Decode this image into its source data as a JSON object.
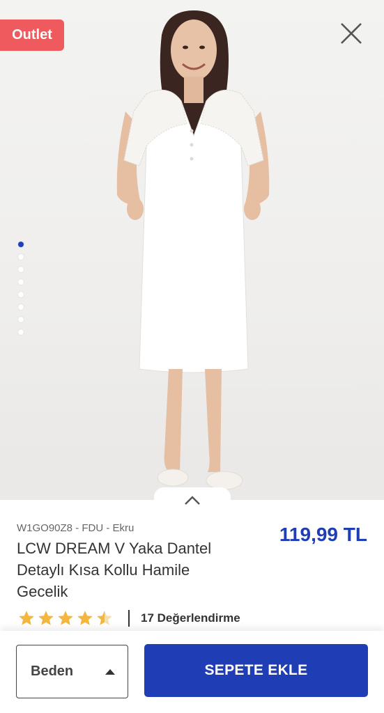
{
  "badge": {
    "label": "Outlet"
  },
  "gallery": {
    "image_count": 8,
    "active_index": 0
  },
  "product": {
    "sku": "W1GO90Z8 - FDU - Ekru",
    "title": "LCW DREAM V Yaka Dantel Detaylı Kısa Kollu Hamile Gecelik",
    "price": "119,99 TL",
    "rating": 4.5,
    "rating_max": 5,
    "review_count": "17 Değerlendirme"
  },
  "actions": {
    "size_label": "Beden",
    "add_to_cart": "SEPETE EKLE"
  },
  "icons": {
    "close": "close-icon",
    "expand": "chevron-up-icon",
    "size_dropdown": "caret-up-icon",
    "rating": "star-icon"
  },
  "colors": {
    "brand_blue": "#1f3db5",
    "outlet_red": "#ef5a5e",
    "star": "#f4b63d",
    "active_dot": "#1f3fbf"
  }
}
